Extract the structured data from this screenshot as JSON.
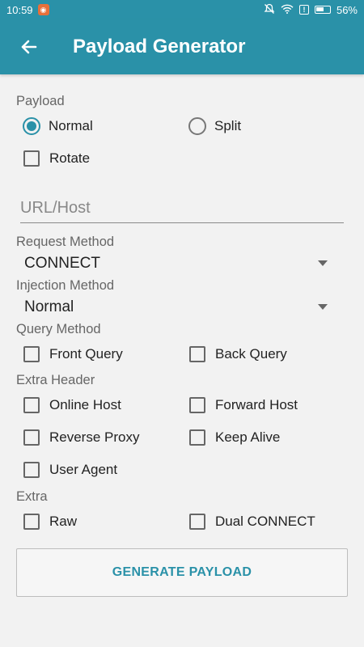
{
  "status": {
    "time": "10:59",
    "battery": "56%",
    "notif_icon": "app-notification-icon"
  },
  "appbar": {
    "title": "Payload Generator",
    "back_icon": "arrow-back-icon"
  },
  "payload": {
    "label": "Payload",
    "normal": "Normal",
    "split": "Split",
    "rotate": "Rotate",
    "selected": "Normal"
  },
  "url": {
    "placeholder": "URL/Host",
    "value": ""
  },
  "request_method": {
    "label": "Request Method",
    "value": "CONNECT"
  },
  "injection_method": {
    "label": "Injection Method",
    "value": "Normal"
  },
  "query_method": {
    "label": "Query Method",
    "front": "Front Query",
    "back": "Back Query"
  },
  "extra_header": {
    "label": "Extra Header",
    "online_host": "Online Host",
    "forward_host": "Forward Host",
    "reverse_proxy": "Reverse Proxy",
    "keep_alive": "Keep Alive",
    "user_agent": "User Agent"
  },
  "extra": {
    "label": "Extra",
    "raw": "Raw",
    "dual_connect": "Dual CONNECT"
  },
  "generate_label": "GENERATE PAYLOAD",
  "colors": {
    "accent": "#2a91a8",
    "background": "#f2f2f2"
  }
}
